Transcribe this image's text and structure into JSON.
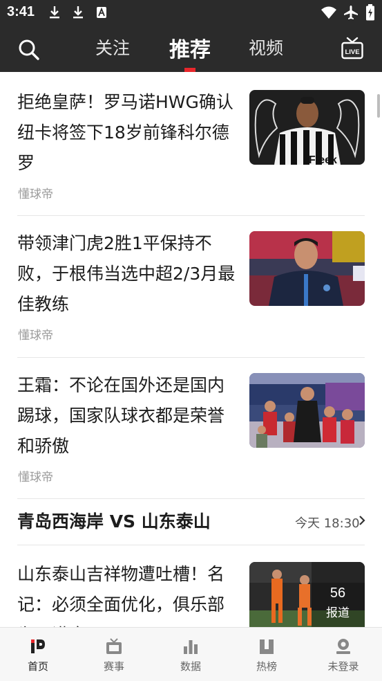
{
  "status_bar": {
    "time": "3:41"
  },
  "top_nav": {
    "tabs": [
      {
        "label": "关注"
      },
      {
        "label": "推荐"
      },
      {
        "label": "视频"
      }
    ],
    "active_tab": "推荐",
    "live_label": "LIVE",
    "accent_color": "#e8272c"
  },
  "articles": [
    {
      "title": "拒绝皇萨！罗马诺HWG确认纽卡将签下18岁前锋科尔德罗",
      "source": "懂球帝",
      "thumb_text": "Fleek"
    },
    {
      "title": "带领津门虎2胜1平保持不败，于根伟当选中超2/3月最佳教练",
      "source": "懂球帝"
    },
    {
      "title": "王霜：不论在国外还是国内踢球，国家队球衣都是荣誉和骄傲",
      "source": "懂球帝"
    },
    {
      "title": "山东泰山吉祥物遭吐槽！名记：必须全面优化，俱乐部为了满意",
      "report_count": "56",
      "report_label": "报道"
    }
  ],
  "match": {
    "title": "青岛西海岸 VS 山东泰山",
    "time": "今天 18:30"
  },
  "bottom_nav": {
    "items": [
      {
        "label": "首页"
      },
      {
        "label": "赛事"
      },
      {
        "label": "数据"
      },
      {
        "label": "热榜"
      },
      {
        "label": "未登录"
      }
    ],
    "active": "首页"
  }
}
